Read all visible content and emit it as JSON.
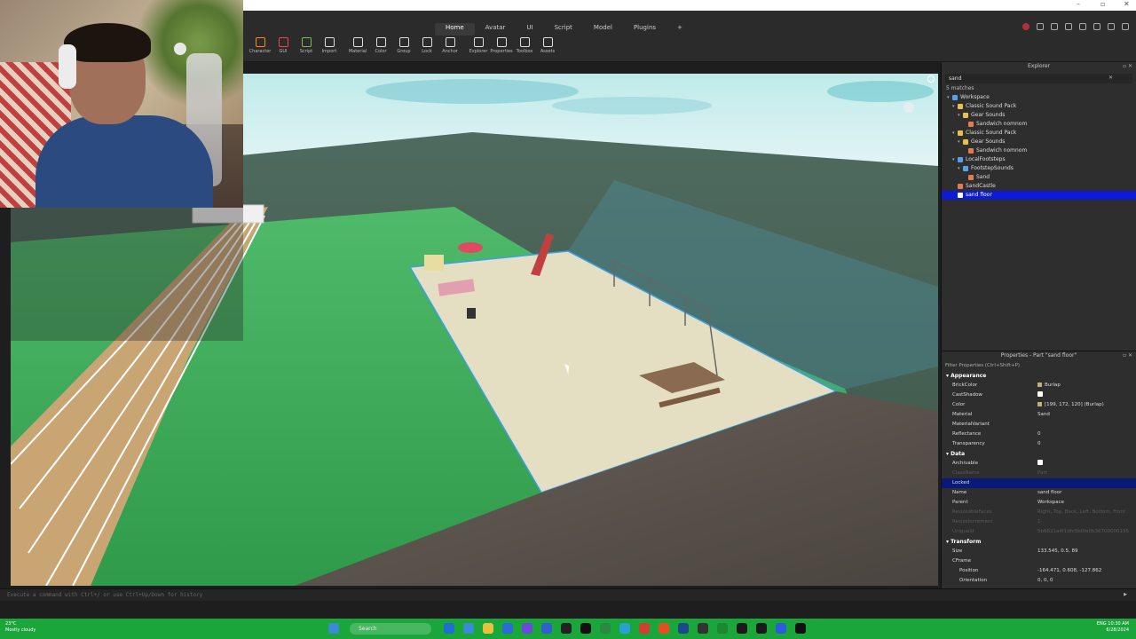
{
  "menu": {
    "tabs": [
      "Home",
      "Avatar",
      "UI",
      "Script",
      "Model",
      "Plugins",
      "+"
    ],
    "active": "Home"
  },
  "toolbar": {
    "items": [
      "Character",
      "GUI",
      "Script",
      "Import",
      "Material",
      "Color",
      "Group",
      "Lock",
      "Anchor",
      "Explorer",
      "Properties",
      "Toolbox",
      "Assets"
    ]
  },
  "explorer": {
    "title": "Explorer",
    "filter_value": "sand",
    "matches": "5 matches",
    "tree": [
      {
        "label": "Workspace",
        "depth": 0,
        "icon_color": "#5aa0e6",
        "icon": "workspace-icon"
      },
      {
        "label": "Classic Sound Pack",
        "depth": 1,
        "icon_color": "#e6c04a",
        "icon": "folder-icon"
      },
      {
        "label": "Gear Sounds",
        "depth": 2,
        "icon_color": "#e6c04a",
        "icon": "folder-icon"
      },
      {
        "label": "Sandwich nomnom",
        "depth": 3,
        "icon_color": "#e67a4a",
        "icon": "sound-icon"
      },
      {
        "label": "Classic Sound Pack",
        "depth": 1,
        "icon_color": "#e6c04a",
        "icon": "folder-icon"
      },
      {
        "label": "Gear Sounds",
        "depth": 2,
        "icon_color": "#e6c04a",
        "icon": "folder-icon"
      },
      {
        "label": "Sandwich nomnom",
        "depth": 3,
        "icon_color": "#e67a4a",
        "icon": "sound-icon"
      },
      {
        "label": "LocalFootsteps",
        "depth": 1,
        "icon_color": "#5aa0e6",
        "icon": "script-icon"
      },
      {
        "label": "FootstepSounds",
        "depth": 2,
        "icon_color": "#5aa0e6",
        "icon": "folder-icon"
      },
      {
        "label": "Sand",
        "depth": 3,
        "icon_color": "#e67a4a",
        "icon": "sound-icon"
      },
      {
        "label": "SandCastle",
        "depth": 1,
        "icon_color": "#e67a4a",
        "icon": "model-icon"
      },
      {
        "label": "sand floor",
        "depth": 1,
        "icon_color": "#ffffff",
        "icon": "part-icon",
        "selected": true
      }
    ]
  },
  "properties": {
    "title": "Properties - Part \"sand floor\"",
    "filter_placeholder": "Filter Properties (Ctrl+Shift+P)",
    "rows": [
      {
        "type": "section",
        "label": "Appearance"
      },
      {
        "k": "BrickColor",
        "v": "Burlap",
        "swatch": "#c7ac78"
      },
      {
        "k": "CastShadow",
        "check": true
      },
      {
        "k": "Color",
        "v": "[199, 172, 120] (Burlap)",
        "swatch": "#c7ac78"
      },
      {
        "k": "Material",
        "v": "Sand"
      },
      {
        "k": "MaterialVariant",
        "v": ""
      },
      {
        "k": "Reflectance",
        "v": "0"
      },
      {
        "k": "Transparency",
        "v": "0"
      },
      {
        "type": "section",
        "label": "Data"
      },
      {
        "k": "Archivable",
        "check": true
      },
      {
        "k": "ClassName",
        "v": "Part",
        "dim": true
      },
      {
        "k": "Locked",
        "v": "",
        "hl": true
      },
      {
        "k": "Name",
        "v": "sand floor"
      },
      {
        "k": "Parent",
        "v": "Workspace"
      },
      {
        "k": "ResizeableFaces",
        "v": "Right, Top, Back, Left, Bottom, Front",
        "dim": true
      },
      {
        "k": "ResizeIncrement",
        "v": "1",
        "dim": true
      },
      {
        "k": "UniqueId",
        "v": "5b6821a4f1dfc5b0fe0b36700000195",
        "dim": true
      },
      {
        "type": "section",
        "label": "Transform"
      },
      {
        "k": "Size",
        "v": "133.545, 0.5, 89"
      },
      {
        "k": "CFrame",
        "v": ""
      },
      {
        "k": "Position",
        "v": "-164.471, 0.608, -127.862",
        "indent": true
      },
      {
        "k": "Orientation",
        "v": "0, 0, 0",
        "indent": true
      }
    ]
  },
  "command_bar": {
    "placeholder": "Execute a command with Ctrl+/ or use Ctrl+Up/Down for history"
  },
  "taskbar": {
    "weather_temp": "23°C",
    "weather_desc": "Mostly cloudy",
    "search_label": "Search",
    "time": "10:30 AM",
    "date": "6/28/2024",
    "lang": "ENG"
  },
  "colors": {
    "accent_selection": "#0e1bd6",
    "taskbar": "#1aa63a",
    "grass": "#3aaa5a",
    "sand": "#e2dcc0"
  }
}
